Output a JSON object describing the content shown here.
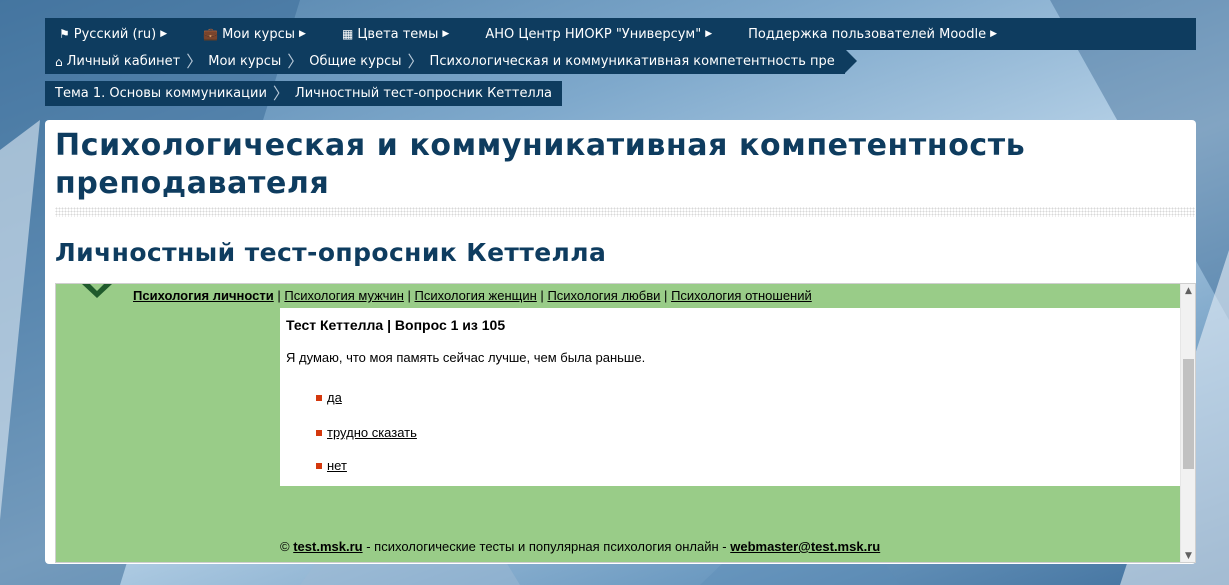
{
  "topnav": {
    "items": [
      {
        "icon": "flag-icon",
        "label": "Русский ‎(ru)‎"
      },
      {
        "icon": "briefcase-icon",
        "label": "Мои курсы"
      },
      {
        "icon": "grid-icon",
        "label": "Цвета темы"
      },
      {
        "icon": "",
        "label": "АНО Центр НИОКР \"Универсум\""
      },
      {
        "icon": "",
        "label": "Поддержка пользователей Moodle"
      }
    ]
  },
  "breadcrumb": {
    "row1": [
      "Личный кабинет",
      "Мои курсы",
      "Общие курсы",
      "Психологическая и коммуникативная компетентность пре"
    ],
    "row2": [
      "Тема 1. Основы коммуникации",
      "Личностный тест-опросник Кеттелла"
    ]
  },
  "course_title": "Психологическая и коммуникативная компетентность преподавателя",
  "page_title": "Личностный тест-опросник Кеттелла",
  "frame": {
    "topics": [
      "Психология личности",
      "Психология мужчин",
      "Психология женщин",
      "Психология любви",
      "Психология отношений"
    ],
    "separator": "|",
    "question_header": "Тест Кеттелла | Вопрос 1 из 105",
    "question_text": "Я думаю, что моя память сейчас лучше, чем была раньше.",
    "answers": [
      "да",
      "трудно сказать",
      "нет"
    ],
    "footer": {
      "copyright": "©",
      "site": "test.msk.ru",
      "middle": "- психологические тесты и популярная психология онлайн -",
      "email": "webmaster@test.msk.ru"
    }
  },
  "colors": {
    "nav": "#0e3c5f",
    "green": "#99cc88",
    "title": "#0e3c5f",
    "bullet": "#d4380d"
  }
}
